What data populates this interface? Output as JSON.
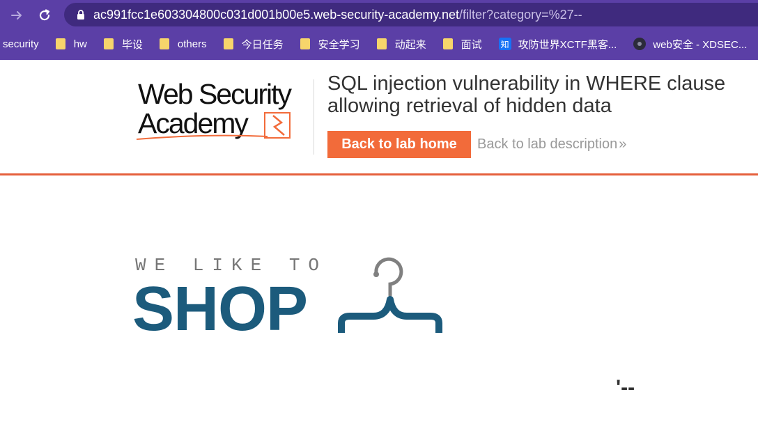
{
  "browser": {
    "url_main": "ac991fcc1e603304800c031d001b00e5.web-security-academy.net",
    "url_rest": "/filter?category=%27--",
    "bookmarks": [
      {
        "label": "security",
        "icon": "none"
      },
      {
        "label": "hw",
        "icon": "folder-icon"
      },
      {
        "label": "毕设",
        "icon": "folder-icon"
      },
      {
        "label": "others",
        "icon": "folder-icon"
      },
      {
        "label": "今日任务",
        "icon": "folder-icon"
      },
      {
        "label": "安全学习",
        "icon": "folder-icon"
      },
      {
        "label": "动起来",
        "icon": "folder-icon"
      },
      {
        "label": "面试",
        "icon": "folder-icon"
      },
      {
        "label": "攻防世界XCTF黑客...",
        "icon": "zhihu-icon",
        "icon_text": "知"
      },
      {
        "label": "web安全 - XDSEC...",
        "icon": "xdsec-icon"
      }
    ],
    "colors": {
      "chrome": "#5b3fa6",
      "omnibox": "#3f2a7e"
    }
  },
  "lab": {
    "logo_line1": "Web Security",
    "logo_line2": "Academy",
    "title": "SQL injection vulnerability in WHERE clause allowing retrieval of hidden data",
    "back_home": "Back to lab home",
    "back_desc": "Back to lab description",
    "colors": {
      "accent": "#f26b3a",
      "rule": "#e5603c"
    }
  },
  "shop": {
    "tagline": "WE LIKE TO",
    "name": "SHOP",
    "color": "#1c5b7c",
    "search_echo": "'--"
  }
}
